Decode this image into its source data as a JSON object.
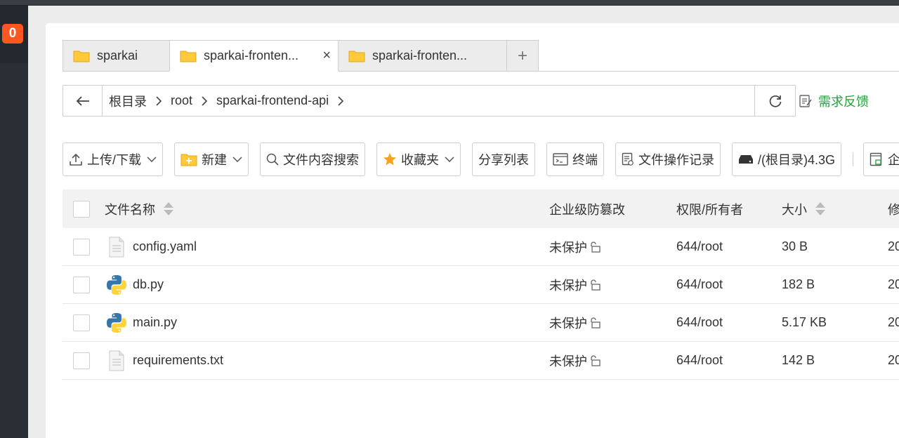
{
  "notification_badge": "0",
  "tabs": [
    {
      "label": "sparkai",
      "active": false
    },
    {
      "label": "sparkai-fronten...",
      "active": true,
      "close": "×"
    },
    {
      "label": "sparkai-fronten...",
      "active": false
    }
  ],
  "add_tab": "+",
  "breadcrumbs": [
    "根目录",
    "root",
    "sparkai-frontend-api"
  ],
  "feedback_label": "需求反馈",
  "toolbar": {
    "upload_download": "上传/下载",
    "new": "新建",
    "content_search": "文件内容搜索",
    "favorites": "收藏夹",
    "share_list": "分享列表",
    "terminal": "终端",
    "operation_log": "文件操作记录",
    "disk": "/(根目录)4.3G",
    "enterprise": "企"
  },
  "table": {
    "headers": {
      "name": "文件名称",
      "tamper": "企业级防篡改",
      "perm": "权限/所有者",
      "size": "大小",
      "modified": "修"
    },
    "rows": [
      {
        "name": "config.yaml",
        "type": "text-file-icon",
        "tamper": "未保护",
        "perm": "644/root",
        "size": "30 B",
        "modified": "20"
      },
      {
        "name": "db.py",
        "type": "python-icon",
        "tamper": "未保护",
        "perm": "644/root",
        "size": "182 B",
        "modified": "20"
      },
      {
        "name": "main.py",
        "type": "python-icon",
        "tamper": "未保护",
        "perm": "644/root",
        "size": "5.17 KB",
        "modified": "20"
      },
      {
        "name": "requirements.txt",
        "type": "text-file-icon",
        "tamper": "未保护",
        "perm": "644/root",
        "size": "142 B",
        "modified": "20"
      }
    ]
  },
  "colors": {
    "accent_green": "#20a53a",
    "badge_orange": "#ff5722",
    "folder_yellow": "#ffc93c"
  }
}
